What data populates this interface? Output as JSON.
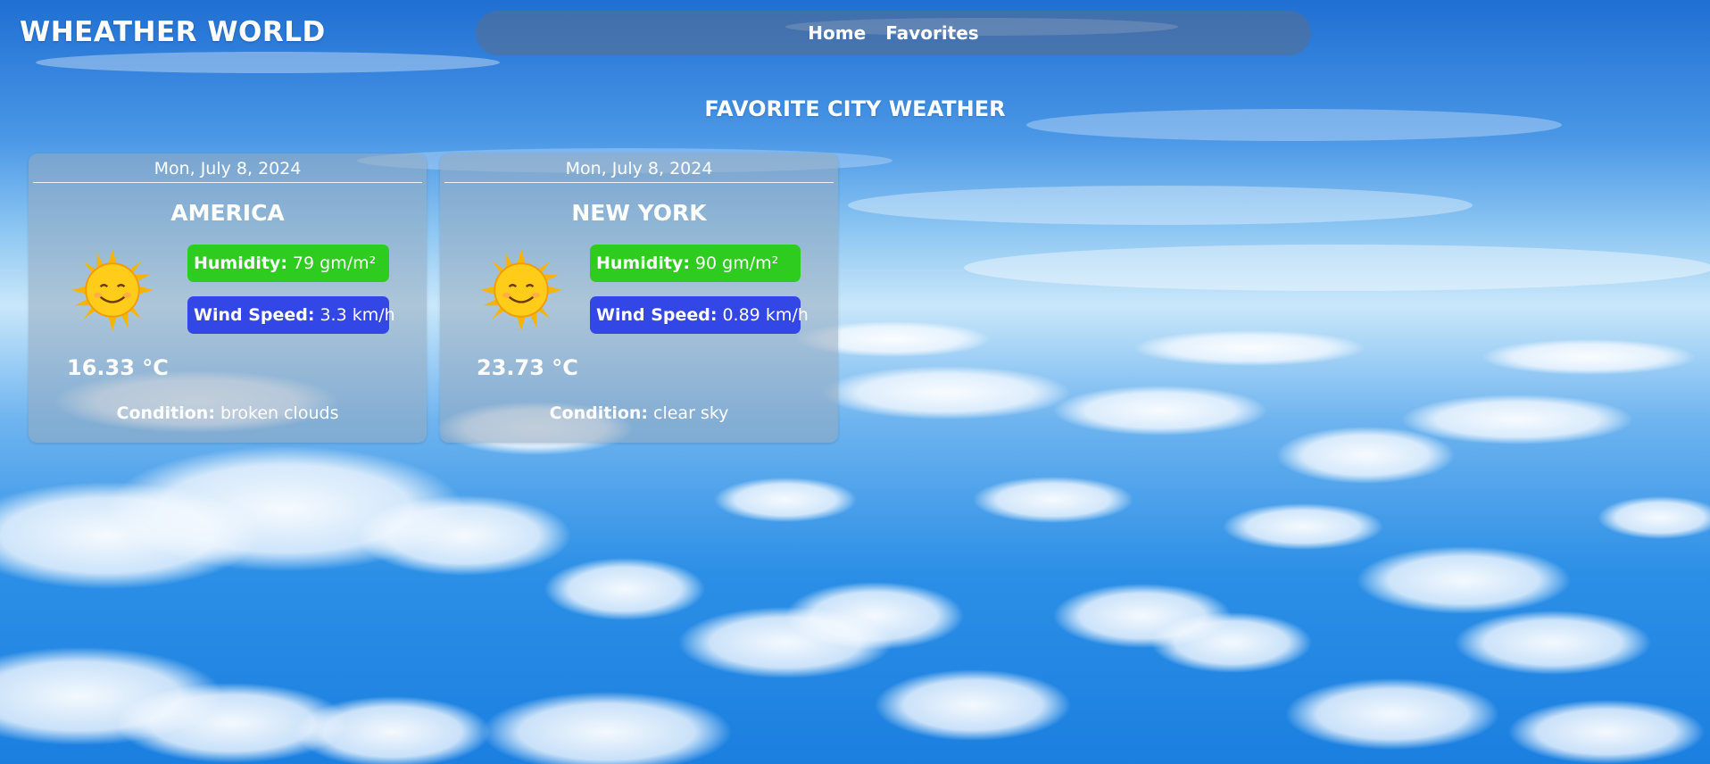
{
  "header": {
    "brand": "WHEATHER WORLD",
    "nav": [
      {
        "label": "Home"
      },
      {
        "label": "Favorites"
      }
    ]
  },
  "page": {
    "title": "FAVORITE CITY WEATHER"
  },
  "colors": {
    "humidity_pill": "#2ecc1f",
    "wind_pill": "#3346e6",
    "card_bg": "rgba(150,170,190,0.55)"
  },
  "cards": [
    {
      "date": "Mon, July 8, 2024",
      "city": "AMERICA",
      "icon": "sun-icon",
      "humidity_label": "Humidity:",
      "humidity_value": "79 gm/m²",
      "wind_label": "Wind Speed:",
      "wind_value": "3.3 km/h",
      "temperature": "16.33 °C",
      "condition_label": "Condition:",
      "condition_value": "broken clouds"
    },
    {
      "date": "Mon, July 8, 2024",
      "city": "NEW YORK",
      "icon": "sun-icon",
      "humidity_label": "Humidity:",
      "humidity_value": "90 gm/m²",
      "wind_label": "Wind Speed:",
      "wind_value": "0.89 km/h",
      "temperature": "23.73 °C",
      "condition_label": "Condition:",
      "condition_value": "clear sky"
    }
  ]
}
